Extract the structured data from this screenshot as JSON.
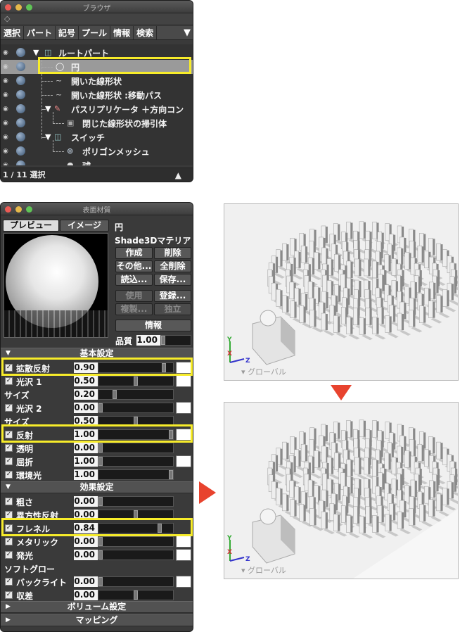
{
  "browser": {
    "title": "ブラウザ",
    "tabs": [
      "選択",
      "パート",
      "記号",
      "プール",
      "情報",
      "検索"
    ],
    "tree": [
      {
        "label": "ルートパート"
      },
      {
        "label": "円"
      },
      {
        "label": "開いた線形状"
      },
      {
        "label": "開いた線形状 :移動パス"
      },
      {
        "label": "パスリプリケータ ＋方向コン"
      },
      {
        "label": "閉じた線形状の掃引体"
      },
      {
        "label": "スイッチ"
      },
      {
        "label": "ポリゴンメッシュ"
      },
      {
        "label": "球"
      }
    ],
    "status": "1 / 11 選択"
  },
  "material": {
    "title": "表面材質",
    "preview_tab": "プレビュー",
    "image_tab": "イメージ",
    "object_name": "円",
    "material_type": "Shade3Dマテリア",
    "buttons": {
      "create": "作成",
      "delete": "削除",
      "other": "その他...",
      "delete_all": "全削除",
      "load": "読込...",
      "save": "保存...",
      "use": "使用",
      "register": "登録...",
      "copy": "複製...",
      "independent": "独立",
      "info": "情報"
    },
    "quality_label": "品質",
    "quality_value": "1.00",
    "sections": {
      "basic": "基本設定",
      "effects": "効果設定",
      "volume": "ボリューム設定",
      "mapping": "マッピング"
    },
    "basic_rows": [
      {
        "label": "拡散反射",
        "value": "0.90",
        "checked": true,
        "level": 0.9
      },
      {
        "label": "光沢 1",
        "value": "0.50",
        "checked": true,
        "level": 0.5
      },
      {
        "label": "サイズ",
        "value": "0.20",
        "checked": false,
        "level": 0.2
      },
      {
        "label": "光沢 2",
        "value": "0.00",
        "checked": true,
        "level": 0
      },
      {
        "label": "サイズ",
        "value": "0.50",
        "checked": false,
        "level": 0.5
      },
      {
        "label": "反射",
        "value": "1.00",
        "checked": true,
        "level": 1
      },
      {
        "label": "透明",
        "value": "0.00",
        "checked": true,
        "level": 0
      },
      {
        "label": "屈折",
        "value": "1.00",
        "checked": true,
        "level": 0
      },
      {
        "label": "環境光",
        "value": "1.00",
        "checked": true,
        "level": 1
      }
    ],
    "effect_rows": [
      {
        "label": "粗さ",
        "value": "0.00",
        "checked": true,
        "level": 0
      },
      {
        "label": "異方性反射",
        "value": "0.00",
        "checked": true,
        "level": 0.5
      },
      {
        "label": "フレネル",
        "value": "0.84",
        "checked": true,
        "level": 0.84
      },
      {
        "label": "メタリック",
        "value": "0.00",
        "checked": true,
        "level": 0
      },
      {
        "label": "発光",
        "value": "0.00",
        "checked": true,
        "level": 0
      },
      {
        "label": "ソフトグロー",
        "value": "",
        "checked": false,
        "level": 0
      },
      {
        "label": "バックライト",
        "value": "0.00",
        "checked": true,
        "level": 0
      },
      {
        "label": "収差",
        "value": "0.00",
        "checked": true,
        "level": 0.5
      }
    ]
  },
  "render": {
    "global_label": "▾ グローバル",
    "axis_x": "X",
    "axis_y": "Y",
    "axis_z": "Z"
  },
  "colors": {
    "highlight": "#f7ec2a",
    "arrow": "#e8432e"
  }
}
